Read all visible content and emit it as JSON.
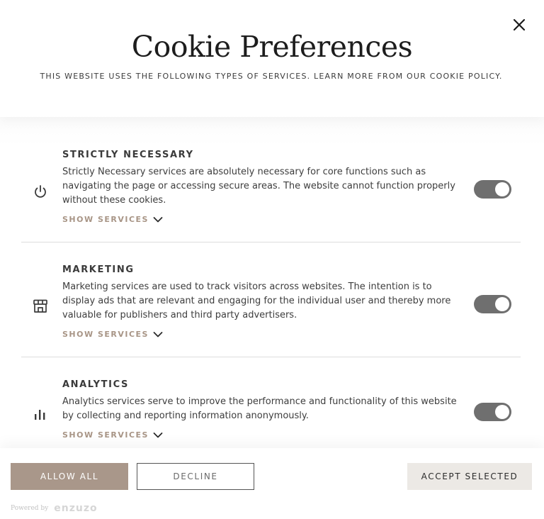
{
  "header": {
    "title": "Cookie Preferences",
    "subtitle": "THIS WEBSITE USES THE FOLLOWING TYPES OF SERVICES. LEARN MORE FROM OUR COOKIE POLICY.",
    "close_icon": "close-icon"
  },
  "sections": [
    {
      "icon": "power-icon",
      "title": "STRICTLY NECESSARY",
      "description": "Strictly Necessary services are absolutely necessary for core functions such as navigating the page or accessing secure areas. The website cannot function properly without these cookies.",
      "show_services": "SHOW SERVICES",
      "enabled": true
    },
    {
      "icon": "store-icon",
      "title": "MARKETING",
      "description": "Marketing services are used to track visitors across websites. The intention is to display ads that are relevant and engaging for the individual user and thereby more valuable for publishers and third party advertisers.",
      "show_services": "SHOW SERVICES",
      "enabled": true
    },
    {
      "icon": "bar-chart-icon",
      "title": "ANALYTICS",
      "description": "Analytics services serve to improve the performance and functionality of this website by collecting and reporting information anonymously.",
      "show_services": "SHOW SERVICES",
      "enabled": true
    }
  ],
  "footer": {
    "allow_all": "ALLOW ALL",
    "decline": "DECLINE",
    "accept_selected": "ACCEPT SELECTED",
    "powered_by": "Powered by",
    "brand": "enzuzo"
  },
  "colors": {
    "accent": "#a9978a",
    "toggle_on": "#6f6f6f",
    "show_services": "#a89586",
    "accept_bg": "#ece9e5"
  }
}
